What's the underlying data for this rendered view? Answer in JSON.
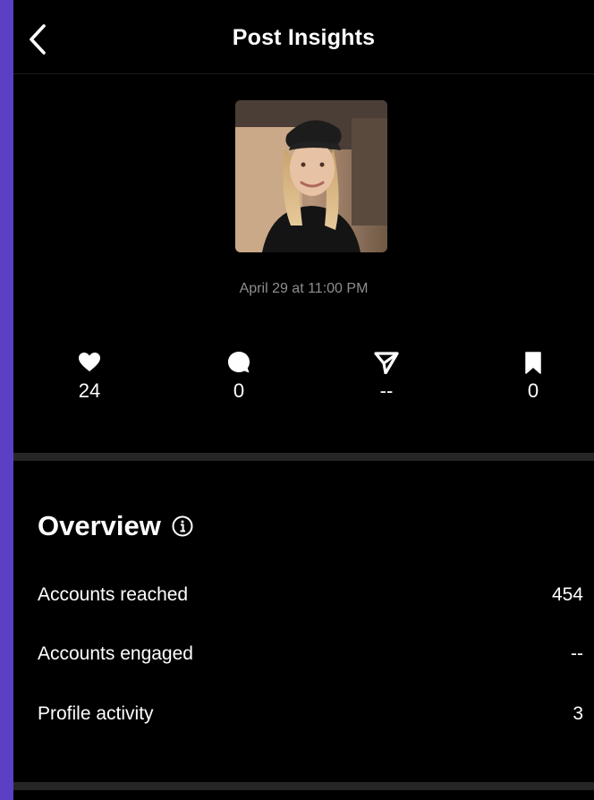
{
  "header": {
    "title": "Post Insights",
    "back_icon": "chevron-left-icon"
  },
  "post": {
    "date": "April 29 at 11:00 PM"
  },
  "stats": [
    {
      "icon": "heart-icon",
      "value": "24"
    },
    {
      "icon": "comment-icon",
      "value": "0"
    },
    {
      "icon": "share-icon",
      "value": "--"
    },
    {
      "icon": "bookmark-icon",
      "value": "0"
    }
  ],
  "overview": {
    "title": "Overview",
    "info_icon": "info-icon",
    "rows": [
      {
        "label": "Accounts reached",
        "value": "454"
      },
      {
        "label": "Accounts engaged",
        "value": "--"
      },
      {
        "label": "Profile activity",
        "value": "3"
      }
    ]
  },
  "colors": {
    "background": "#000000",
    "text": "#ffffff",
    "muted": "#8e8e8e",
    "divider": "#262626",
    "edge": "#5b3fc4"
  }
}
